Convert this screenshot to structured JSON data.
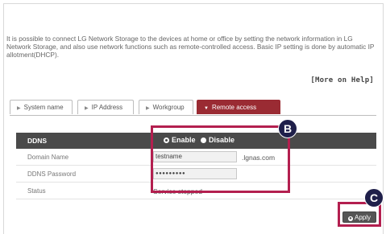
{
  "intro_text": "It is possible to connect LG Network Storage to the devices at home or office by setting the network information in LG Network Storage, and also use network functions such as remote-controlled access. Basic IP setting is done by automatic IP allotment(DHCP).",
  "help_link": "[More on Help]",
  "tabs": [
    {
      "label": "System name",
      "active": false
    },
    {
      "label": "IP Address",
      "active": false
    },
    {
      "label": "Workgroup",
      "active": false
    },
    {
      "label": "Remote access (DDNS)",
      "active": true
    }
  ],
  "ddns": {
    "header_label": "DDNS",
    "enable_label": "Enable",
    "disable_label": "Disable",
    "selected": "Enable",
    "domain_label": "Domain Name",
    "domain_value": "testname",
    "domain_suffix": ".lgnas.com",
    "password_label": "DDNS Password",
    "password_value": "●●●●●●●●●",
    "status_label": "Status",
    "status_value": "Service stopped"
  },
  "callouts": {
    "b": "B",
    "c": "C"
  },
  "apply_label": "Apply",
  "colors": {
    "accent_tab": "#9a2b33",
    "highlight_box": "#b31f4f",
    "callout_bg": "#1f1f4a",
    "header_bg": "#4a4a4a"
  }
}
